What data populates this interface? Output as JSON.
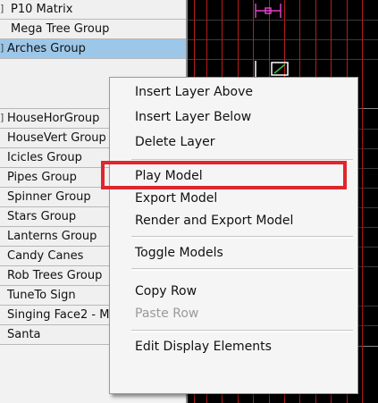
{
  "model_list": {
    "rows": [
      {
        "label": "P10 Matrix",
        "expander": "]",
        "selected": false
      },
      {
        "label": "Mega Tree Group",
        "expander": "",
        "selected": false
      },
      {
        "label": "Arches Group",
        "expander": "]",
        "selected": true
      },
      {
        "label": "",
        "expander": "",
        "selected": false
      },
      {
        "label": "HouseHorGroup",
        "expander": "]",
        "selected": false
      },
      {
        "label": "HouseVert Group",
        "expander": "",
        "selected": false
      },
      {
        "label": "Icicles Group",
        "expander": "",
        "selected": false
      },
      {
        "label": "Pipes Group",
        "expander": "",
        "selected": false
      },
      {
        "label": "Spinner Group",
        "expander": "",
        "selected": false
      },
      {
        "label": "Stars Group",
        "expander": "",
        "selected": false
      },
      {
        "label": "Lanterns Group",
        "expander": "",
        "selected": false
      },
      {
        "label": "Candy Canes",
        "expander": "",
        "selected": false
      },
      {
        "label": "Rob Trees Group",
        "expander": "",
        "selected": false
      },
      {
        "label": "TuneTo Sign",
        "expander": "",
        "selected": false
      },
      {
        "label": "Singing Face2 - Matrix",
        "expander": "",
        "selected": false
      },
      {
        "label": "Santa",
        "expander": "",
        "selected": false
      }
    ]
  },
  "context_menu": {
    "items": [
      {
        "label": "Insert Layer Above",
        "enabled": true
      },
      {
        "label": "Insert Layer Below",
        "enabled": true
      },
      {
        "label": "Delete Layer",
        "enabled": true
      },
      {
        "label": "Play Model",
        "enabled": true,
        "highlighted": true
      },
      {
        "label": "Export Model",
        "enabled": true
      },
      {
        "label": "Render and Export Model",
        "enabled": true
      },
      {
        "label": "Toggle Models",
        "enabled": true
      },
      {
        "label": "Copy Row",
        "enabled": true
      },
      {
        "label": "Paste Row",
        "enabled": false
      },
      {
        "label": "Edit Display Elements",
        "enabled": true
      }
    ]
  },
  "colors": {
    "selection": "#9cc7e9",
    "highlight_box": "#e0262c",
    "timeline_bg": "#000000",
    "timing_marks": "#b81c1c",
    "effect_magenta": "#e040c8"
  }
}
